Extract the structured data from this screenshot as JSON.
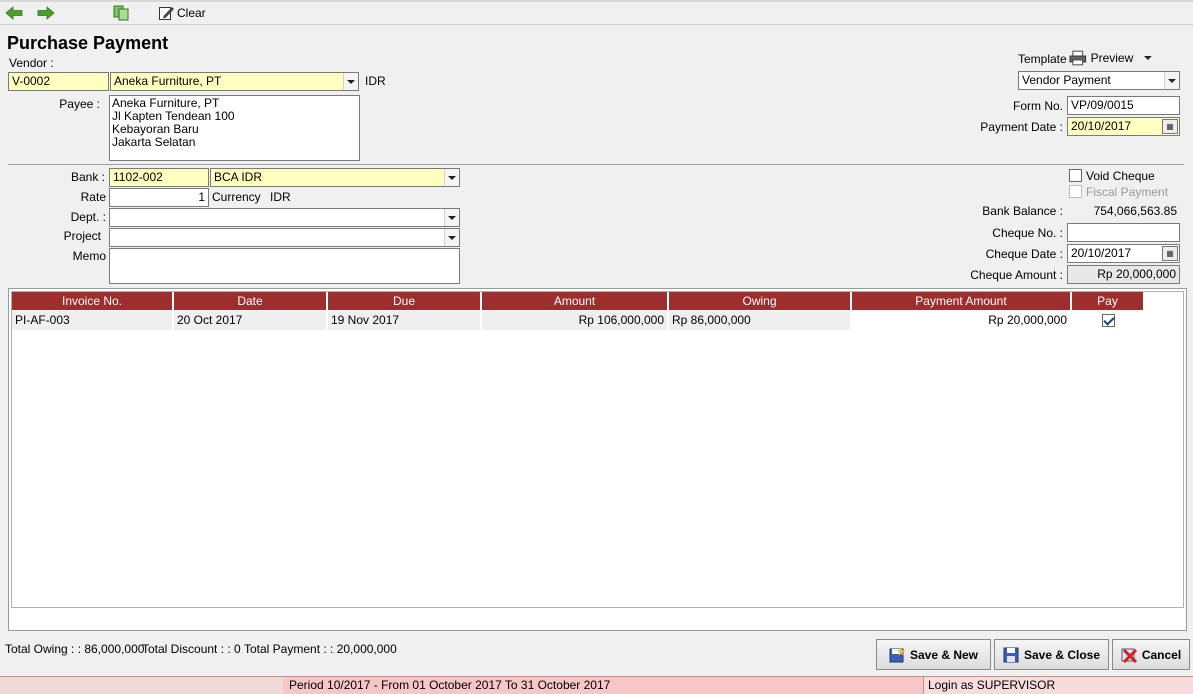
{
  "toolbar": {
    "clear_label": "Clear"
  },
  "form": {
    "title": "Purchase Payment",
    "vendor_label": "Vendor :",
    "vendor_code": "V-0002",
    "vendor_name": "Aneka Furniture, PT",
    "vendor_currency": "IDR",
    "payee_label": "Payee :",
    "payee_lines": [
      "Aneka Furniture, PT",
      "Jl Kapten Tendean 100",
      "Kebayoran Baru",
      "Jakarta Selatan"
    ],
    "template_label": "Template",
    "preview_label": "Preview",
    "template_value": "Vendor Payment",
    "form_no_label": "Form No.",
    "form_no_value": "VP/09/0015",
    "payment_date_label": "Payment Date :",
    "payment_date_value": "20/10/2017",
    "bank_label": "Bank :",
    "bank_code": "1102-002",
    "bank_name": "BCA IDR",
    "rate_label": "Rate",
    "rate_value": "1",
    "currency_label": "Currency",
    "currency_value": "IDR",
    "dept_label": "Dept. :",
    "dept_value": "",
    "project_label": "Project",
    "project_value": "",
    "memo_label": "Memo",
    "memo_value": "",
    "void_cheque_label": "Void Cheque",
    "fiscal_payment_label": "Fiscal Payment",
    "bank_balance_label": "Bank Balance :",
    "bank_balance_value": "754,066,563.85",
    "cheque_no_label": "Cheque No. :",
    "cheque_no_value": "",
    "cheque_date_label": "Cheque Date :",
    "cheque_date_value": "20/10/2017",
    "cheque_amount_label": "Cheque Amount :",
    "cheque_amount_value": "Rp 20,000,000"
  },
  "grid": {
    "columns": [
      "Invoice No.",
      "Date",
      "Due",
      "Amount",
      "Owing",
      "Payment Amount",
      "Pay"
    ],
    "rows": [
      {
        "invoice_no": "PI-AF-003",
        "date": "20 Oct 2017",
        "due": "19 Nov 2017",
        "amount": "Rp 106,000,000",
        "owing": "Rp 86,000,000",
        "payment_amount": "Rp 20,000,000",
        "pay": true
      }
    ]
  },
  "footer": {
    "total_owing": "Total Owing : : 86,000,000",
    "total_discount": "Total Discount : : 0",
    "total_payment": "Total Payment : : 20,000,000",
    "save_new_label": "Save & New",
    "save_close_label": "Save & Close",
    "cancel_label": "Cancel"
  },
  "status": {
    "period": "Period 10/2017 - From 01 October 2017 To 31 October 2017",
    "login": "Login as SUPERVISOR"
  },
  "colors": {
    "header_red": "#9e2d2d",
    "required_yellow": "#ffffc0"
  }
}
